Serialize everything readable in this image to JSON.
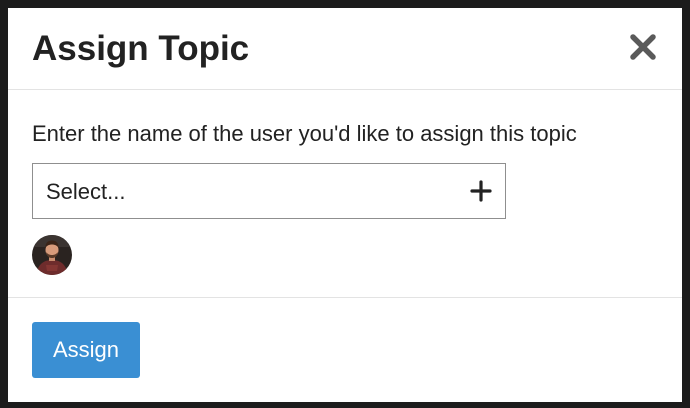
{
  "modal": {
    "title": "Assign Topic",
    "instructions": "Enter the name of the user you'd like to assign this topic",
    "select_placeholder": "Select...",
    "assign_label": "Assign"
  },
  "icons": {
    "close": "close-icon",
    "add": "plus-icon",
    "avatar": "user-avatar"
  },
  "colors": {
    "primary_button": "#3a8fd3",
    "title_text": "#222222"
  }
}
